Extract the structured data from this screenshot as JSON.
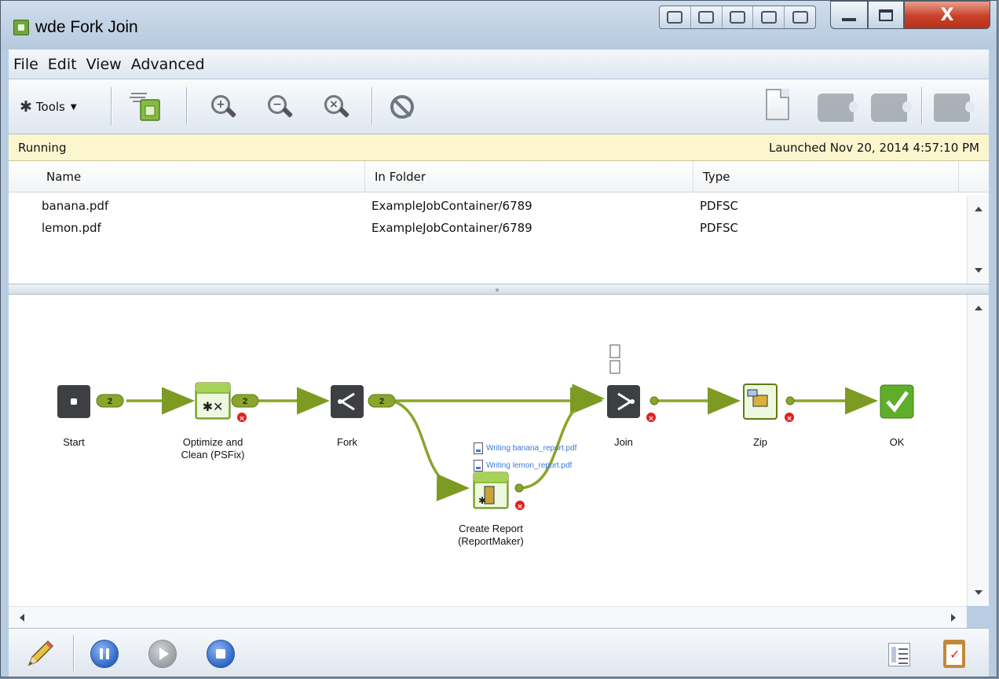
{
  "window": {
    "title": "wde Fork Join",
    "close_glyph": "X"
  },
  "menu": {
    "items": [
      "File",
      "Edit",
      "View",
      "Advanced"
    ]
  },
  "toolbar": {
    "tools_label": "Tools",
    "icons": [
      "gear-icon",
      "flow-document-icon",
      "zoom-in-icon",
      "zoom-out-icon",
      "zoom-reset-icon",
      "stop-sign-icon",
      "new-document-icon",
      "favorite-icon",
      "remove-icon",
      "ticket-icon"
    ]
  },
  "status": {
    "state": "Running",
    "launched": "Launched Nov 20, 2014 4:57:10 PM"
  },
  "table": {
    "columns": [
      "Name",
      "In Folder",
      "Type"
    ],
    "rows": [
      {
        "name": "banana.pdf",
        "folder": "ExampleJobContainer/6789",
        "type": "PDFSC"
      },
      {
        "name": "lemon.pdf",
        "folder": "ExampleJobContainer/6789",
        "type": "PDFSC"
      }
    ]
  },
  "flow": {
    "nodes": {
      "start": "Start",
      "optimize": [
        "Optimize and",
        "Clean (PSFix)"
      ],
      "fork": "Fork",
      "report": [
        "Create Report",
        "(ReportMaker)"
      ],
      "join": "Join",
      "zip": "Zip",
      "ok": "OK"
    },
    "badges": {
      "start": "2",
      "optimize": "2",
      "fork": "2"
    },
    "writing": [
      "Writing banana_report.pdf",
      "Writing lemon_report.pdf"
    ],
    "colors": {
      "connector": "#8aa52c",
      "connector_dark": "#5f7a14",
      "node_dark": "#3d3f42",
      "node_green": "#8bbf3f",
      "error": "#e02020",
      "ok": "#5fae2a"
    }
  },
  "bottom": {
    "icons": [
      "edit-pencil-icon",
      "pause-icon",
      "play-icon",
      "stop-icon",
      "job-list-icon",
      "checklist-icon"
    ]
  }
}
